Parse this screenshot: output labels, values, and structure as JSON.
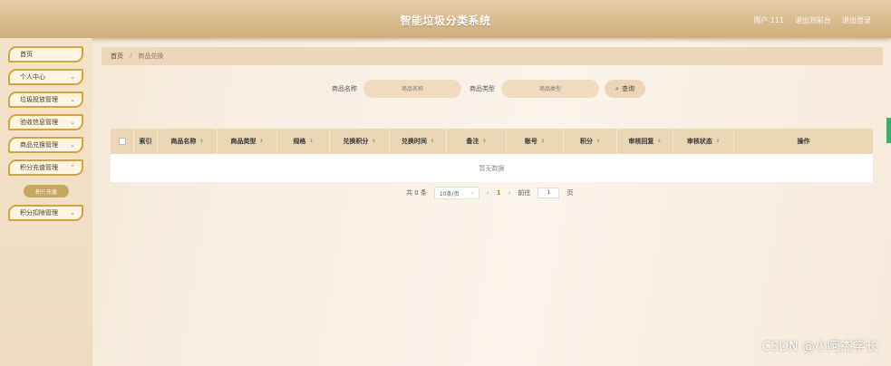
{
  "header": {
    "title": "智能垃圾分类系统",
    "links": [
      "用户 111",
      "退出到前台",
      "退出登录"
    ]
  },
  "sidebar": {
    "items": [
      {
        "label": "首页",
        "has_chevron": false
      },
      {
        "label": "个人中心",
        "has_chevron": true
      },
      {
        "label": "垃圾投放管理",
        "has_chevron": true
      },
      {
        "label": "验收信息管理",
        "has_chevron": true
      },
      {
        "label": "商品兑换管理",
        "has_chevron": true
      },
      {
        "label": "积分充值管理",
        "has_chevron": true
      },
      {
        "label": "积分扣除管理",
        "has_chevron": true
      }
    ],
    "active_submenu": "积分充值"
  },
  "breadcrumb": {
    "home": "首页",
    "separator": "/",
    "current": "商品兑换"
  },
  "search": {
    "name_label": "商品名称",
    "name_placeholder": "商品名称",
    "type_label": "商品类型",
    "type_placeholder": "商品类型",
    "button_label": "查询"
  },
  "table": {
    "columns": [
      "索引",
      "商品名称",
      "商品类型",
      "规格",
      "兑换积分",
      "兑换时间",
      "备注",
      "账号",
      "积分",
      "审核回复",
      "审核状态",
      "操作"
    ],
    "empty_text": "暂无数据"
  },
  "pagination": {
    "total_text": "共 0 条",
    "page_size": "10条/页",
    "current_page": "1",
    "goto_label": "前往",
    "goto_value": "1",
    "page_suffix": "页"
  },
  "watermark": "CSDN @小阿杰学长",
  "colors": {
    "accent": "#d4a536",
    "header": "#d9bb8d",
    "table_header": "#ebd6b6"
  }
}
